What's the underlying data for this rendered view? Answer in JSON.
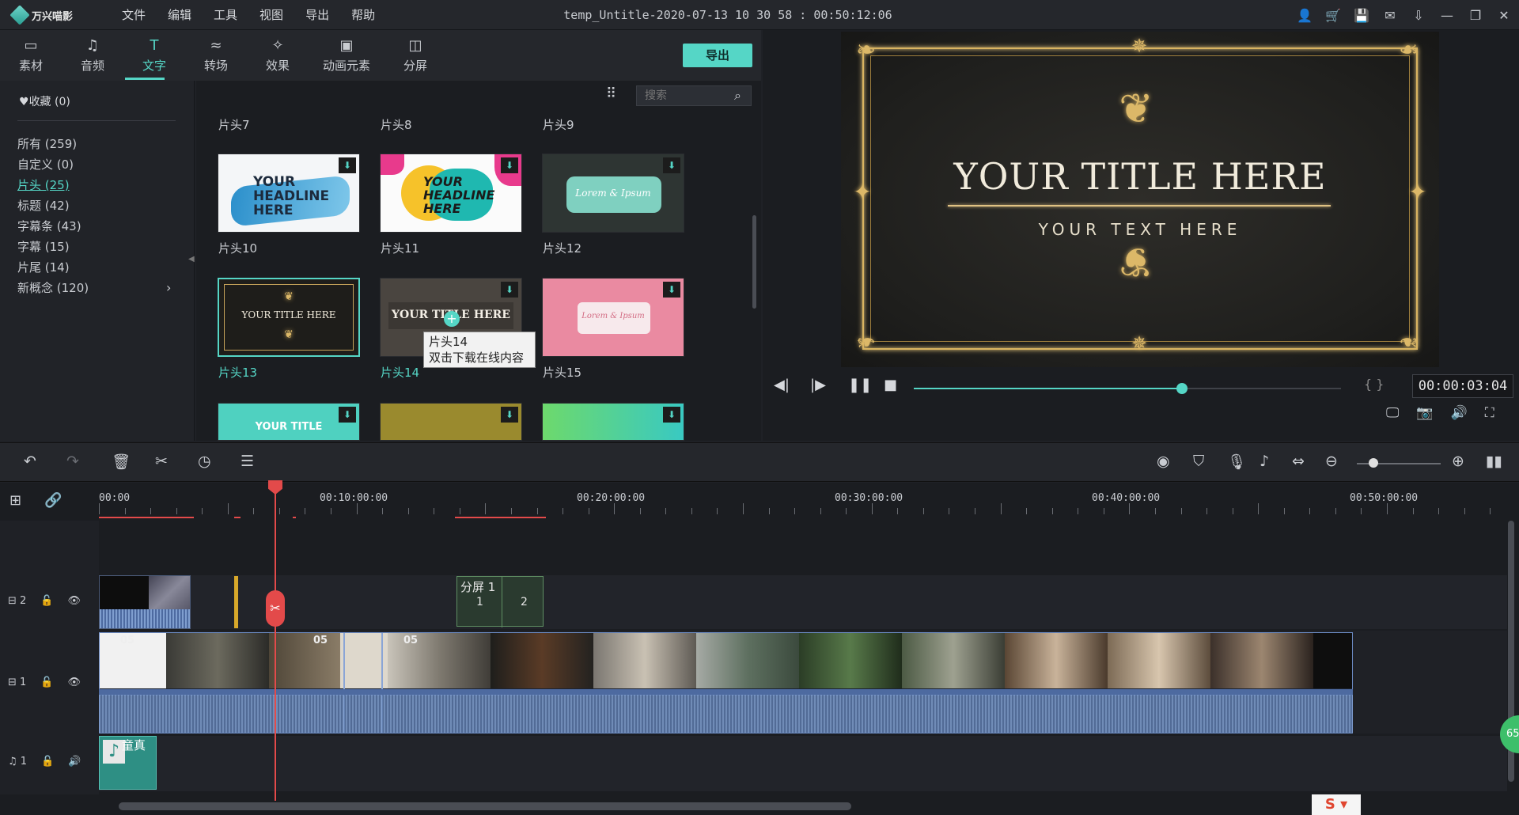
{
  "app": {
    "logo": "万兴喵影"
  },
  "menu": [
    "文件",
    "编辑",
    "工具",
    "视图",
    "导出",
    "帮助"
  ],
  "window_title": "temp_Untitle-2020-07-13 10 30 58 : 00:50:12:06",
  "library_tabs": [
    {
      "label": "素材",
      "icon": "folder-icon"
    },
    {
      "label": "音频",
      "icon": "music-note-icon"
    },
    {
      "label": "文字",
      "icon": "text-icon",
      "active": true
    },
    {
      "label": "转场",
      "icon": "transition-icon"
    },
    {
      "label": "效果",
      "icon": "effects-icon"
    },
    {
      "label": "动画元素",
      "icon": "image-icon"
    },
    {
      "label": "分屏",
      "icon": "split-screen-icon"
    }
  ],
  "export_label": "导出",
  "favorites": "收藏 (0)",
  "categories": [
    "所有 (259)",
    "自定义 (0)",
    "片头 (25)",
    "标题 (42)",
    "字幕条 (43)",
    "字幕 (15)",
    "片尾 (14)",
    "新概念 (120)"
  ],
  "search": {
    "placeholder": "搜索"
  },
  "templates": {
    "row0": [
      "片头7",
      "片头8",
      "片头9"
    ],
    "row1": [
      "片头10",
      "片头11",
      "片头12"
    ],
    "row2": [
      "片头13",
      "片头14",
      "片头15"
    ],
    "thumb10": "YOUR HEADLINE HERE",
    "thumb11": "YOUR HEADLINE HERE",
    "thumb12": "Lorem & Ipsum",
    "thumb13": "YOUR TITLE HERE",
    "thumb14": "YOUR TITLE HERE",
    "thumb15": "Lorem & Ipsum",
    "thumb16": "YOUR TITLE"
  },
  "tooltip": {
    "line1": "片头14",
    "line2": "双击下载在线内容"
  },
  "preview": {
    "title": "YOUR TITLE HERE",
    "subtitle": "YOUR TEXT HERE",
    "timecode": "00:00:03:04",
    "progress": 0.628,
    "brackets": "{ }"
  },
  "colors": {
    "accent": "#55d6c6",
    "playhead": "#e34a4a",
    "gold": "#d9b461"
  },
  "ruler": [
    "00:00",
    "00:10:00:00",
    "00:20:00:00",
    "00:30:00:00",
    "00:40:00:00",
    "00:50:00:00"
  ],
  "tracks": {
    "video2": "2",
    "video1": "1",
    "audio1": "1",
    "split_label": "分屏 1",
    "split_cells": [
      "1",
      "2"
    ],
    "clip_num": "05",
    "music_clip": "童真"
  },
  "zoom_level": 0.2,
  "badge": "65"
}
